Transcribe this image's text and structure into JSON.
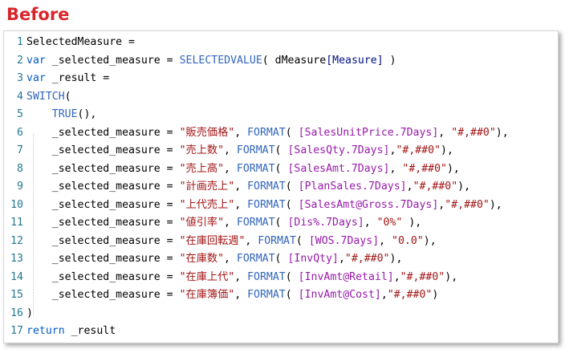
{
  "heading": "Before",
  "code_lines": [
    {
      "n": "1",
      "tokens": [
        {
          "t": "SelectedMeasure =",
          "c": "plain"
        }
      ]
    },
    {
      "n": "2",
      "tokens": [
        {
          "t": "var",
          "c": "kw"
        },
        {
          "t": " _selected_measure = ",
          "c": "plain"
        },
        {
          "t": "SELECTEDVALUE",
          "c": "fn"
        },
        {
          "t": "( dMeasure",
          "c": "plain"
        },
        {
          "t": "[Measure]",
          "c": "col"
        },
        {
          "t": " )",
          "c": "plain"
        }
      ]
    },
    {
      "n": "3",
      "tokens": [
        {
          "t": "var",
          "c": "kw"
        },
        {
          "t": " _result =",
          "c": "plain"
        }
      ]
    },
    {
      "n": "4",
      "tokens": [
        {
          "t": "SWITCH",
          "c": "fn"
        },
        {
          "t": "(",
          "c": "plain"
        }
      ]
    },
    {
      "n": "5",
      "tokens": [
        {
          "t": "    ",
          "c": "plain"
        },
        {
          "t": "TRUE",
          "c": "fn"
        },
        {
          "t": "(),",
          "c": "plain"
        }
      ]
    },
    {
      "n": "6",
      "tokens": [
        {
          "t": "    _selected_measure = ",
          "c": "plain"
        },
        {
          "t": "\"販売価格\"",
          "c": "str"
        },
        {
          "t": ", ",
          "c": "plain"
        },
        {
          "t": "FORMAT",
          "c": "fn"
        },
        {
          "t": "( ",
          "c": "plain"
        },
        {
          "t": "[SalesUnitPrice.7Days]",
          "c": "ms"
        },
        {
          "t": ", ",
          "c": "plain"
        },
        {
          "t": "\"#,##0\"",
          "c": "str"
        },
        {
          "t": "),",
          "c": "plain"
        }
      ]
    },
    {
      "n": "7",
      "tokens": [
        {
          "t": "    _selected_measure = ",
          "c": "plain"
        },
        {
          "t": "\"売上数\"",
          "c": "str"
        },
        {
          "t": ", ",
          "c": "plain"
        },
        {
          "t": "FORMAT",
          "c": "fn"
        },
        {
          "t": "( ",
          "c": "plain"
        },
        {
          "t": "[SalesQty.7Days]",
          "c": "ms"
        },
        {
          "t": ",",
          "c": "plain"
        },
        {
          "t": "\"#,##0\"",
          "c": "str"
        },
        {
          "t": "),",
          "c": "plain"
        }
      ]
    },
    {
      "n": "8",
      "tokens": [
        {
          "t": "    _selected_measure = ",
          "c": "plain"
        },
        {
          "t": "\"売上高\"",
          "c": "str"
        },
        {
          "t": ", ",
          "c": "plain"
        },
        {
          "t": "FORMAT",
          "c": "fn"
        },
        {
          "t": "( ",
          "c": "plain"
        },
        {
          "t": "[SalesAmt.7Days]",
          "c": "ms"
        },
        {
          "t": ", ",
          "c": "plain"
        },
        {
          "t": "\"#,##0\"",
          "c": "str"
        },
        {
          "t": "),",
          "c": "plain"
        }
      ]
    },
    {
      "n": "9",
      "tokens": [
        {
          "t": "    _selected_measure = ",
          "c": "plain"
        },
        {
          "t": "\"計画売上\"",
          "c": "str"
        },
        {
          "t": ", ",
          "c": "plain"
        },
        {
          "t": "FORMAT",
          "c": "fn"
        },
        {
          "t": "( ",
          "c": "plain"
        },
        {
          "t": "[PlanSales.7Days]",
          "c": "ms"
        },
        {
          "t": ",",
          "c": "plain"
        },
        {
          "t": "\"#,##0\"",
          "c": "str"
        },
        {
          "t": "),",
          "c": "plain"
        }
      ]
    },
    {
      "n": "10",
      "tokens": [
        {
          "t": "    _selected_measure = ",
          "c": "plain"
        },
        {
          "t": "\"上代売上\"",
          "c": "str"
        },
        {
          "t": ", ",
          "c": "plain"
        },
        {
          "t": "FORMAT",
          "c": "fn"
        },
        {
          "t": "( ",
          "c": "plain"
        },
        {
          "t": "[SalesAmt@Gross.7Days]",
          "c": "ms"
        },
        {
          "t": ",",
          "c": "plain"
        },
        {
          "t": "\"#,##0\"",
          "c": "str"
        },
        {
          "t": "),",
          "c": "plain"
        }
      ]
    },
    {
      "n": "11",
      "tokens": [
        {
          "t": "    _selected_measure = ",
          "c": "plain"
        },
        {
          "t": "\"値引率\"",
          "c": "str"
        },
        {
          "t": ", ",
          "c": "plain"
        },
        {
          "t": "FORMAT",
          "c": "fn"
        },
        {
          "t": "( ",
          "c": "plain"
        },
        {
          "t": "[Dis%.7Days]",
          "c": "ms"
        },
        {
          "t": ", ",
          "c": "plain"
        },
        {
          "t": "\"0%\"",
          "c": "str"
        },
        {
          "t": " ),",
          "c": "plain"
        }
      ]
    },
    {
      "n": "12",
      "tokens": [
        {
          "t": "    _selected_measure = ",
          "c": "plain"
        },
        {
          "t": "\"在庫回転週\"",
          "c": "str"
        },
        {
          "t": ", ",
          "c": "plain"
        },
        {
          "t": "FORMAT",
          "c": "fn"
        },
        {
          "t": "( ",
          "c": "plain"
        },
        {
          "t": "[WOS.7Days]",
          "c": "ms"
        },
        {
          "t": ", ",
          "c": "plain"
        },
        {
          "t": "\"0.0\"",
          "c": "str"
        },
        {
          "t": "),",
          "c": "plain"
        }
      ]
    },
    {
      "n": "13",
      "tokens": [
        {
          "t": "    _selected_measure = ",
          "c": "plain"
        },
        {
          "t": "\"在庫数\"",
          "c": "str"
        },
        {
          "t": ", ",
          "c": "plain"
        },
        {
          "t": "FORMAT",
          "c": "fn"
        },
        {
          "t": "( ",
          "c": "plain"
        },
        {
          "t": "[InvQty]",
          "c": "ms"
        },
        {
          "t": ",",
          "c": "plain"
        },
        {
          "t": "\"#,##0\"",
          "c": "str"
        },
        {
          "t": "),",
          "c": "plain"
        }
      ]
    },
    {
      "n": "14",
      "tokens": [
        {
          "t": "    _selected_measure = ",
          "c": "plain"
        },
        {
          "t": "\"在庫上代\"",
          "c": "str"
        },
        {
          "t": ", ",
          "c": "plain"
        },
        {
          "t": "FORMAT",
          "c": "fn"
        },
        {
          "t": "( ",
          "c": "plain"
        },
        {
          "t": "[InvAmt@Retail]",
          "c": "ms"
        },
        {
          "t": ",",
          "c": "plain"
        },
        {
          "t": "\"#,##0\"",
          "c": "str"
        },
        {
          "t": "),",
          "c": "plain"
        }
      ]
    },
    {
      "n": "15",
      "tokens": [
        {
          "t": "    _selected_measure = ",
          "c": "plain"
        },
        {
          "t": "\"在庫簿価\"",
          "c": "str"
        },
        {
          "t": ", ",
          "c": "plain"
        },
        {
          "t": "FORMAT",
          "c": "fn"
        },
        {
          "t": "( ",
          "c": "plain"
        },
        {
          "t": "[InvAmt@Cost]",
          "c": "ms"
        },
        {
          "t": ",",
          "c": "plain"
        },
        {
          "t": "\"#,##0\"",
          "c": "str"
        },
        {
          "t": ")",
          "c": "plain"
        }
      ]
    },
    {
      "n": "16",
      "tokens": [
        {
          "t": ")",
          "c": "plain"
        }
      ]
    },
    {
      "n": "17",
      "tokens": [
        {
          "t": "return",
          "c": "kw"
        },
        {
          "t": " _result",
          "c": "plain"
        }
      ]
    }
  ],
  "colors": {
    "heading": "#d9262c",
    "keyword": "#035aca",
    "function": "#3165bb",
    "string": "#a31515",
    "column": "#001080",
    "measure": "#971aa9",
    "line_number": "#237893"
  },
  "icons": []
}
